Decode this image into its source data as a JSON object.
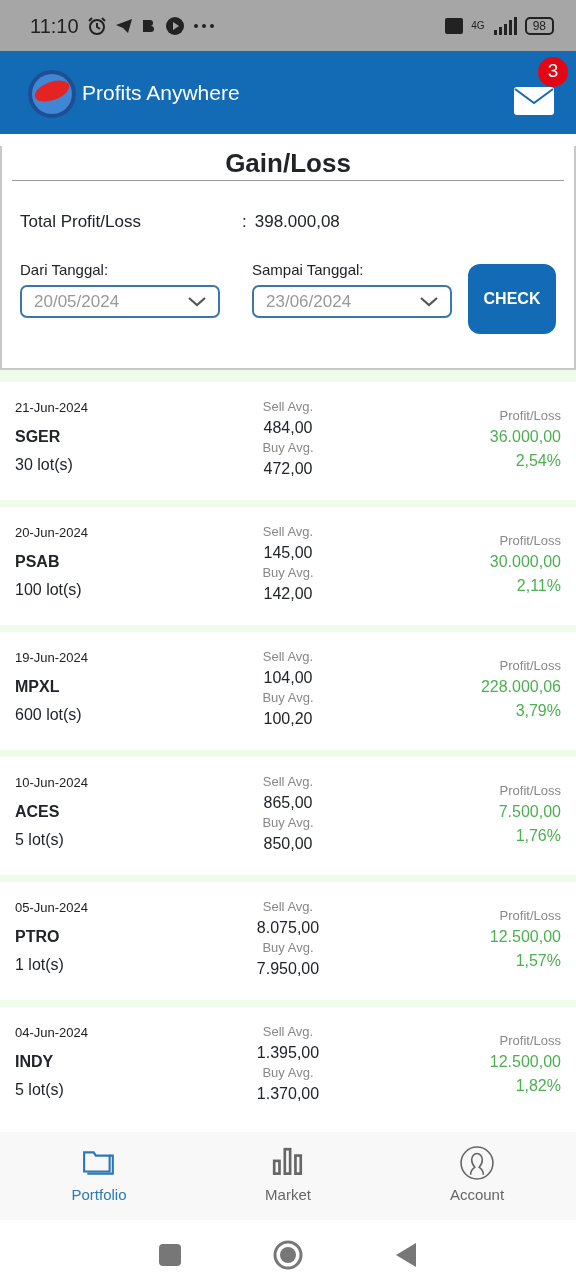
{
  "status_bar": {
    "time": "11:10",
    "network": "4G",
    "battery": "98"
  },
  "header": {
    "title": "Profits Anywhere",
    "unread_count": "3"
  },
  "summary": {
    "title": "Gain/Loss",
    "total_label": "Total Profit/Loss",
    "separator": ":",
    "total_value": "398.000,08",
    "from_label": "Dari Tanggal:",
    "from_value": "20/05/2024",
    "to_label": "Sampai Tanggal:",
    "to_value": "23/06/2024",
    "check_button": "CHECK"
  },
  "trades": [
    {
      "date": "21-Jun-2024",
      "code": "SGER",
      "lots": "30 lot(s)",
      "sell_label": "Sell Avg.",
      "sell": "484,00",
      "buy_label": "Buy Avg.",
      "buy": "472,00",
      "pl_label": "Profit/Loss",
      "pl": "36.000,00",
      "pct": "2,54%",
      "color": "#4caf50"
    },
    {
      "date": "20-Jun-2024",
      "code": "PSAB",
      "lots": "100 lot(s)",
      "sell_label": "Sell Avg.",
      "sell": "145,00",
      "buy_label": "Buy Avg.",
      "buy": "142,00",
      "pl_label": "Profit/Loss",
      "pl": "30.000,00",
      "pct": "2,11%",
      "color": "#4caf50"
    },
    {
      "date": "19-Jun-2024",
      "code": "MPXL",
      "lots": "600 lot(s)",
      "sell_label": "Sell Avg.",
      "sell": "104,00",
      "buy_label": "Buy Avg.",
      "buy": "100,20",
      "pl_label": "Profit/Loss",
      "pl": "228.000,06",
      "pct": "3,79%",
      "color": "#4caf50"
    },
    {
      "date": "10-Jun-2024",
      "code": "ACES",
      "lots": "5 lot(s)",
      "sell_label": "Sell Avg.",
      "sell": "865,00",
      "buy_label": "Buy Avg.",
      "buy": "850,00",
      "pl_label": "Profit/Loss",
      "pl": "7.500,00",
      "pct": "1,76%",
      "color": "#4caf50"
    },
    {
      "date": "05-Jun-2024",
      "code": "PTRO",
      "lots": "1 lot(s)",
      "sell_label": "Sell Avg.",
      "sell": "8.075,00",
      "buy_label": "Buy Avg.",
      "buy": "7.950,00",
      "pl_label": "Profit/Loss",
      "pl": "12.500,00",
      "pct": "1,57%",
      "color": "#4caf50"
    },
    {
      "date": "04-Jun-2024",
      "code": "INDY",
      "lots": "5 lot(s)",
      "sell_label": "Sell Avg.",
      "sell": "1.395,00",
      "buy_label": "Buy Avg.",
      "buy": "1.370,00",
      "pl_label": "Profit/Loss",
      "pl": "12.500,00",
      "pct": "1,82%",
      "color": "#4caf50"
    }
  ],
  "bottom_nav": [
    {
      "kind": "folder",
      "label": "Portfolio",
      "selected": true
    },
    {
      "kind": "bars",
      "label": "Market",
      "selected": false
    },
    {
      "kind": "person",
      "label": "Account",
      "selected": false
    }
  ]
}
